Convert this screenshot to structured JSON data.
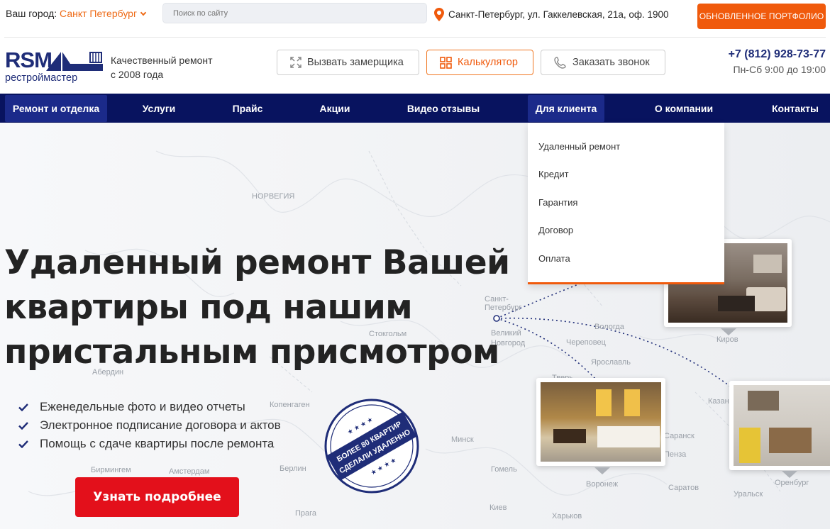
{
  "topbar": {
    "city_label": "Ваш город:",
    "city_value": "Санкт Петербург",
    "search_placeholder": "Поиск по сайту",
    "address": "Санкт-Петербург, ул. Гаккелевская, 21а, оф. 1900",
    "portfolio_button": "Обновленное портфолио"
  },
  "header": {
    "logo_main": "RSM",
    "logo_sub": "рестроймастер",
    "tagline_line1": "Качественный ремонт",
    "tagline_line2": "с 2008 года",
    "measure_button": "Вызвать замерщика",
    "calc_button": "Калькулятор",
    "call_button": "Заказать звонок",
    "phone": "+7 (812) 928-73-77",
    "hours": "Пн-Сб 9:00 до 19:00"
  },
  "nav": {
    "items": [
      {
        "label": "Ремонт и отделка"
      },
      {
        "label": "Услуги"
      },
      {
        "label": "Прайс"
      },
      {
        "label": "Акции"
      },
      {
        "label": "Видео отзывы"
      },
      {
        "label": "Для клиента"
      },
      {
        "label": "О компании"
      },
      {
        "label": "Контакты"
      }
    ]
  },
  "dropdown": {
    "items": [
      {
        "label": "Удаленный ремонт"
      },
      {
        "label": "Кредит"
      },
      {
        "label": "Гарантия"
      },
      {
        "label": "Договор"
      },
      {
        "label": "Оплата"
      }
    ]
  },
  "hero": {
    "title_line1": "Удаленный ремонт Вашей",
    "title_line2": "квартиры под нашим",
    "title_line3": "пристальным присмотром",
    "bullets": [
      "Еженедельные фото и видео отчеты",
      "Электронное подписание договора и актов",
      "Помощь с сдаче квартиры после ремонта"
    ],
    "more_button": "Узнать подробнее",
    "stamp_line1": "БОЛЕЕ 80 КВАРТИР",
    "stamp_line2": "СДЕЛАЛИ УДАЛЕННО"
  },
  "map": {
    "labels": {
      "norway": "НОРВЕГИЯ",
      "spb": "Санкт-Петербург",
      "vnovgorod": "Великий Новгород",
      "vologda": "Вологда",
      "cherepovets": "Череповец",
      "yaroslavl": "Ярославль",
      "kirov": "Киров",
      "tver": "Тверь",
      "kazan": "Казань",
      "minsk": "Минск",
      "penza": "Пенза",
      "saransk": "Саранск",
      "gomel": "Гомель",
      "voronezh": "Воронеж",
      "saratov": "Саратов",
      "orenburg": "Оренбург",
      "uralsk": "Уральск",
      "kiev": "Киев",
      "kharkov": "Харьков",
      "berlin": "Берлин",
      "praha": "Прага",
      "amsterdam": "Амстердам",
      "birmingham": "Бирмингем",
      "copenhagen": "Копенгаген",
      "stockholm": "Стокгольм",
      "aberdeen": "Абердин"
    }
  },
  "colors": {
    "accent": "#f05a0c",
    "navy": "#08135f",
    "red": "#e3101b"
  }
}
